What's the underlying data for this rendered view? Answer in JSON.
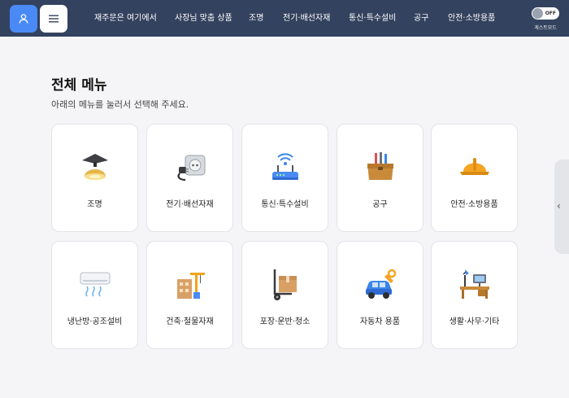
{
  "header": {
    "nav_items": [
      "재주문은 여기에서",
      "사장님 맞춤 상품",
      "조명",
      "전기·배선자재",
      "통신·특수설비",
      "공구",
      "안전·소방용품"
    ],
    "toggle_label": "OFF",
    "guest_mode_label": "게스트모드",
    "user_icon": "user-icon",
    "menu_icon": "hamburger-icon"
  },
  "main": {
    "title": "전체 메뉴",
    "subtitle": "아래의 메뉴를 눌러서 선택해 주세요.",
    "categories": [
      {
        "label": "조명",
        "icon": "lamp-icon"
      },
      {
        "label": "전기·배선자재",
        "icon": "plug-socket-icon"
      },
      {
        "label": "통신·특수설비",
        "icon": "router-icon"
      },
      {
        "label": "공구",
        "icon": "toolbox-icon"
      },
      {
        "label": "안전·소방용품",
        "icon": "hard-hat-icon"
      },
      {
        "label": "냉난방·공조설비",
        "icon": "air-conditioner-icon"
      },
      {
        "label": "건축·철물자재",
        "icon": "building-crane-icon"
      },
      {
        "label": "포장·운반·청소",
        "icon": "hand-truck-icon"
      },
      {
        "label": "자동차 용품",
        "icon": "car-wrench-icon"
      },
      {
        "label": "생활·사무·기타",
        "icon": "office-desk-icon"
      }
    ]
  },
  "side_tab": {
    "icon": "chevron-left-icon"
  },
  "colors": {
    "header_bg": "#33425e",
    "accent": "#4a8af6",
    "page_bg": "#f5f5f7"
  }
}
